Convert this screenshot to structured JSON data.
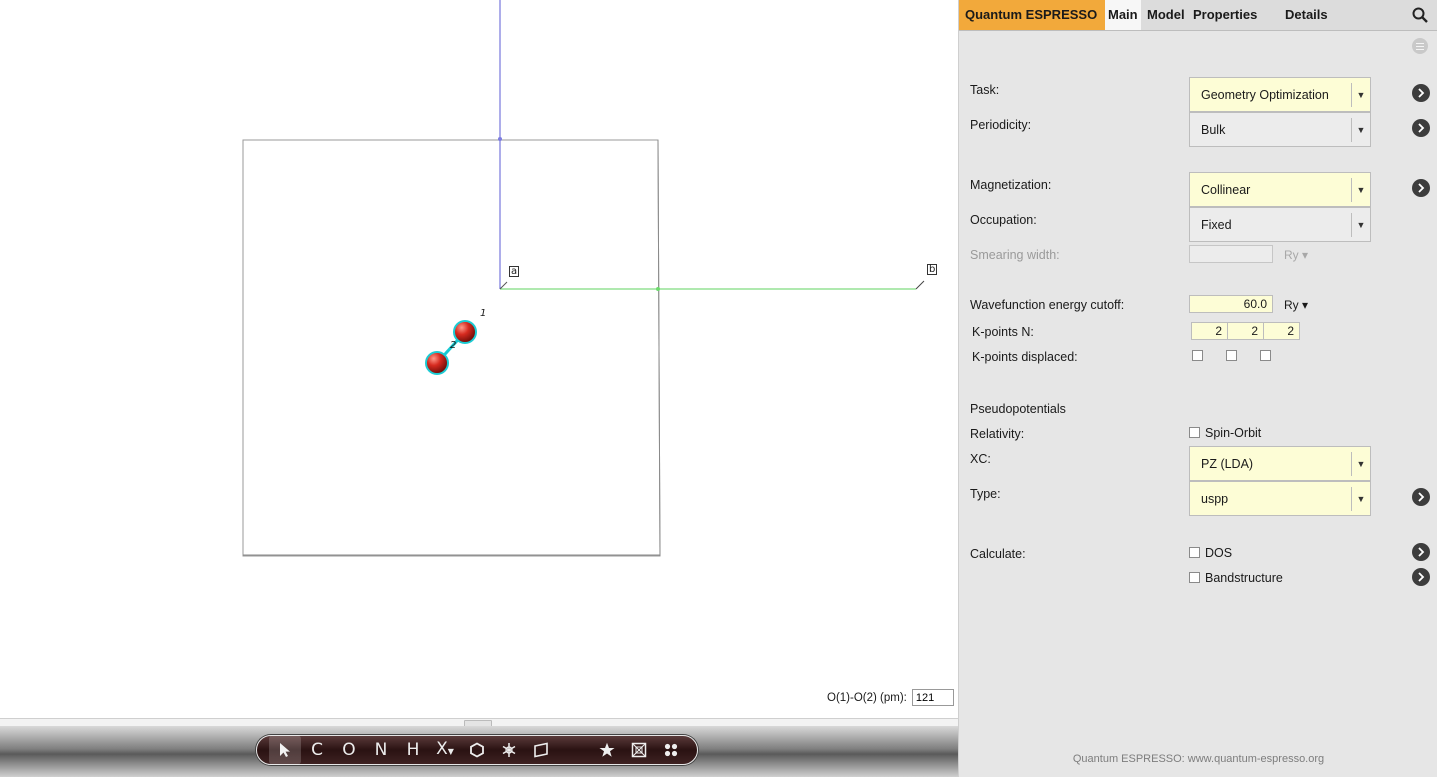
{
  "viewer": {
    "axis_labels": {
      "a": "a",
      "b": "b"
    },
    "atom_labels": [
      "1",
      "2"
    ],
    "measurement": {
      "label": "O(1)-O(2) (pm):",
      "value": "121"
    }
  },
  "toolbar": {
    "tools": [
      {
        "id": "select",
        "icon": "arrow-cursor-icon",
        "label": ""
      },
      {
        "id": "carbon",
        "label": "C"
      },
      {
        "id": "oxygen",
        "label": "O"
      },
      {
        "id": "nitrogen",
        "label": "N"
      },
      {
        "id": "hydrogen",
        "label": "H"
      },
      {
        "id": "other-element",
        "label": "X"
      },
      {
        "id": "ring",
        "icon": "hexagon-icon",
        "label": ""
      },
      {
        "id": "crystal",
        "icon": "snowflake-icon",
        "label": ""
      },
      {
        "id": "surface",
        "icon": "plane-icon",
        "label": ""
      },
      {
        "id": "favorites",
        "icon": "star-icon",
        "label": ""
      },
      {
        "id": "cell",
        "icon": "cube-icon",
        "label": ""
      },
      {
        "id": "fragments",
        "icon": "dots-icon",
        "label": ""
      }
    ]
  },
  "panel": {
    "tabs": {
      "app": "Quantum ESPRESSO",
      "main": "Main",
      "model": "Model",
      "properties": "Properties",
      "details": "Details"
    },
    "task": {
      "label": "Task:",
      "value": "Geometry Optimization"
    },
    "periodicity": {
      "label": "Periodicity:",
      "value": "Bulk"
    },
    "magnetization": {
      "label": "Magnetization:",
      "value": "Collinear"
    },
    "occupation": {
      "label": "Occupation:",
      "value": "Fixed"
    },
    "smearing": {
      "label": "Smearing width:",
      "value": "",
      "unit": "Ry ▾"
    },
    "cutoff": {
      "label": "Wavefunction energy cutoff:",
      "value": "60.0",
      "unit": "Ry ▾"
    },
    "kpoints": {
      "label": "K-points N:",
      "values": [
        "2",
        "2",
        "2"
      ]
    },
    "kdisplaced": {
      "label": "K-points displaced:"
    },
    "pseudo": {
      "heading": "Pseudopotentials",
      "relativity_label": "Relativity:",
      "spin_orbit_label": "Spin-Orbit"
    },
    "xc": {
      "label": "XC:",
      "value": "PZ (LDA)"
    },
    "type": {
      "label": "Type:",
      "value": "uspp"
    },
    "calculate": {
      "label": "Calculate:",
      "dos_label": "DOS",
      "band_label": "Bandstructure"
    },
    "footer": "Quantum ESPRESSO: www.quantum-espresso.org"
  }
}
